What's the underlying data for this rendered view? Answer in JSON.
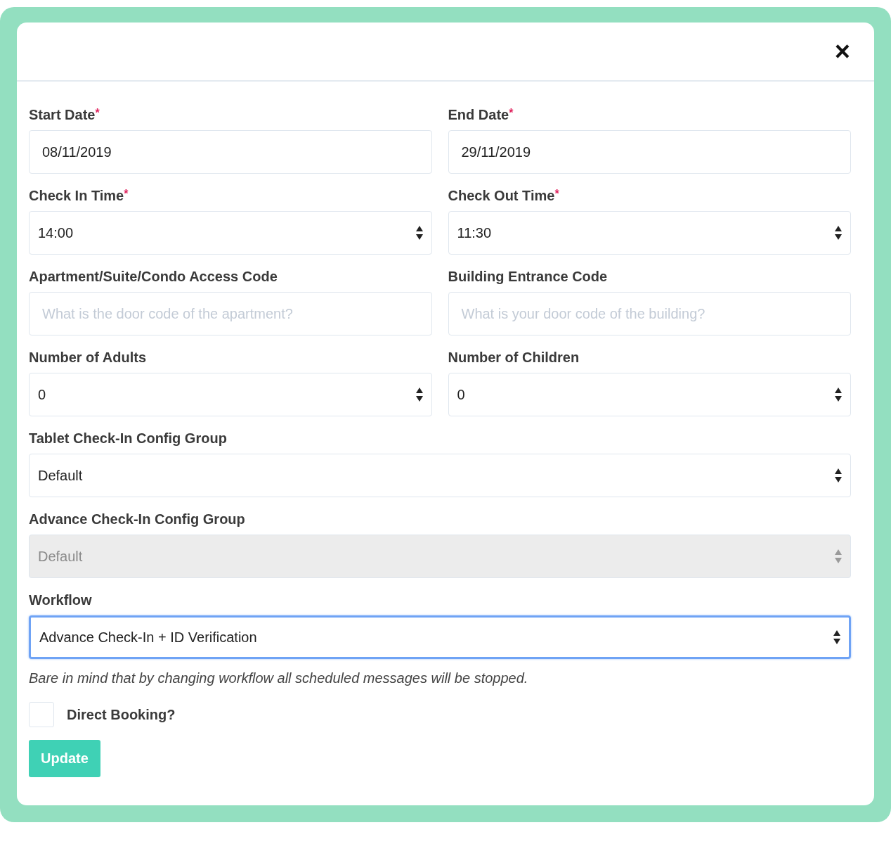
{
  "dialog": {
    "close": "×"
  },
  "required_mark": "*",
  "rows": [
    [
      {
        "label": "Start Date",
        "required": true,
        "kind": "text",
        "value": "08/11/2019"
      },
      {
        "label": "End Date",
        "required": true,
        "kind": "text",
        "value": "29/11/2019"
      }
    ],
    [
      {
        "label": "Check In Time",
        "required": true,
        "kind": "select",
        "value": "14:00",
        "disabled": false,
        "focused": false
      },
      {
        "label": "Check Out Time",
        "required": true,
        "kind": "select",
        "value": "11:30",
        "disabled": false,
        "focused": false
      }
    ],
    [
      {
        "label": "Apartment/Suite/Condo Access Code",
        "required": false,
        "kind": "text",
        "placeholder": "What is the door code of the apartment?"
      },
      {
        "label": "Building Entrance Code",
        "required": false,
        "kind": "text",
        "placeholder": "What is your door code of the building?"
      }
    ],
    [
      {
        "label": "Number of Adults",
        "required": false,
        "kind": "select",
        "value": "0",
        "disabled": false,
        "focused": false
      },
      {
        "label": "Number of Children",
        "required": false,
        "kind": "select",
        "value": "0",
        "disabled": false,
        "focused": false
      }
    ],
    [
      {
        "label": "Tablet Check-In Config Group",
        "required": false,
        "kind": "select",
        "value": "Default",
        "disabled": false,
        "focused": false
      }
    ],
    [
      {
        "label": "Advance Check-In Config Group",
        "required": false,
        "kind": "select",
        "value": "Default",
        "disabled": true,
        "focused": false
      }
    ],
    [
      {
        "label": "Workflow",
        "required": false,
        "kind": "select",
        "value": "Advance Check-In + ID Verification",
        "disabled": false,
        "focused": true
      }
    ]
  ],
  "note": "Bare in mind that by changing workflow all scheduled messages will be stopped.",
  "checkbox": {
    "label": "Direct Booking?",
    "checked": false
  },
  "button": "Update"
}
